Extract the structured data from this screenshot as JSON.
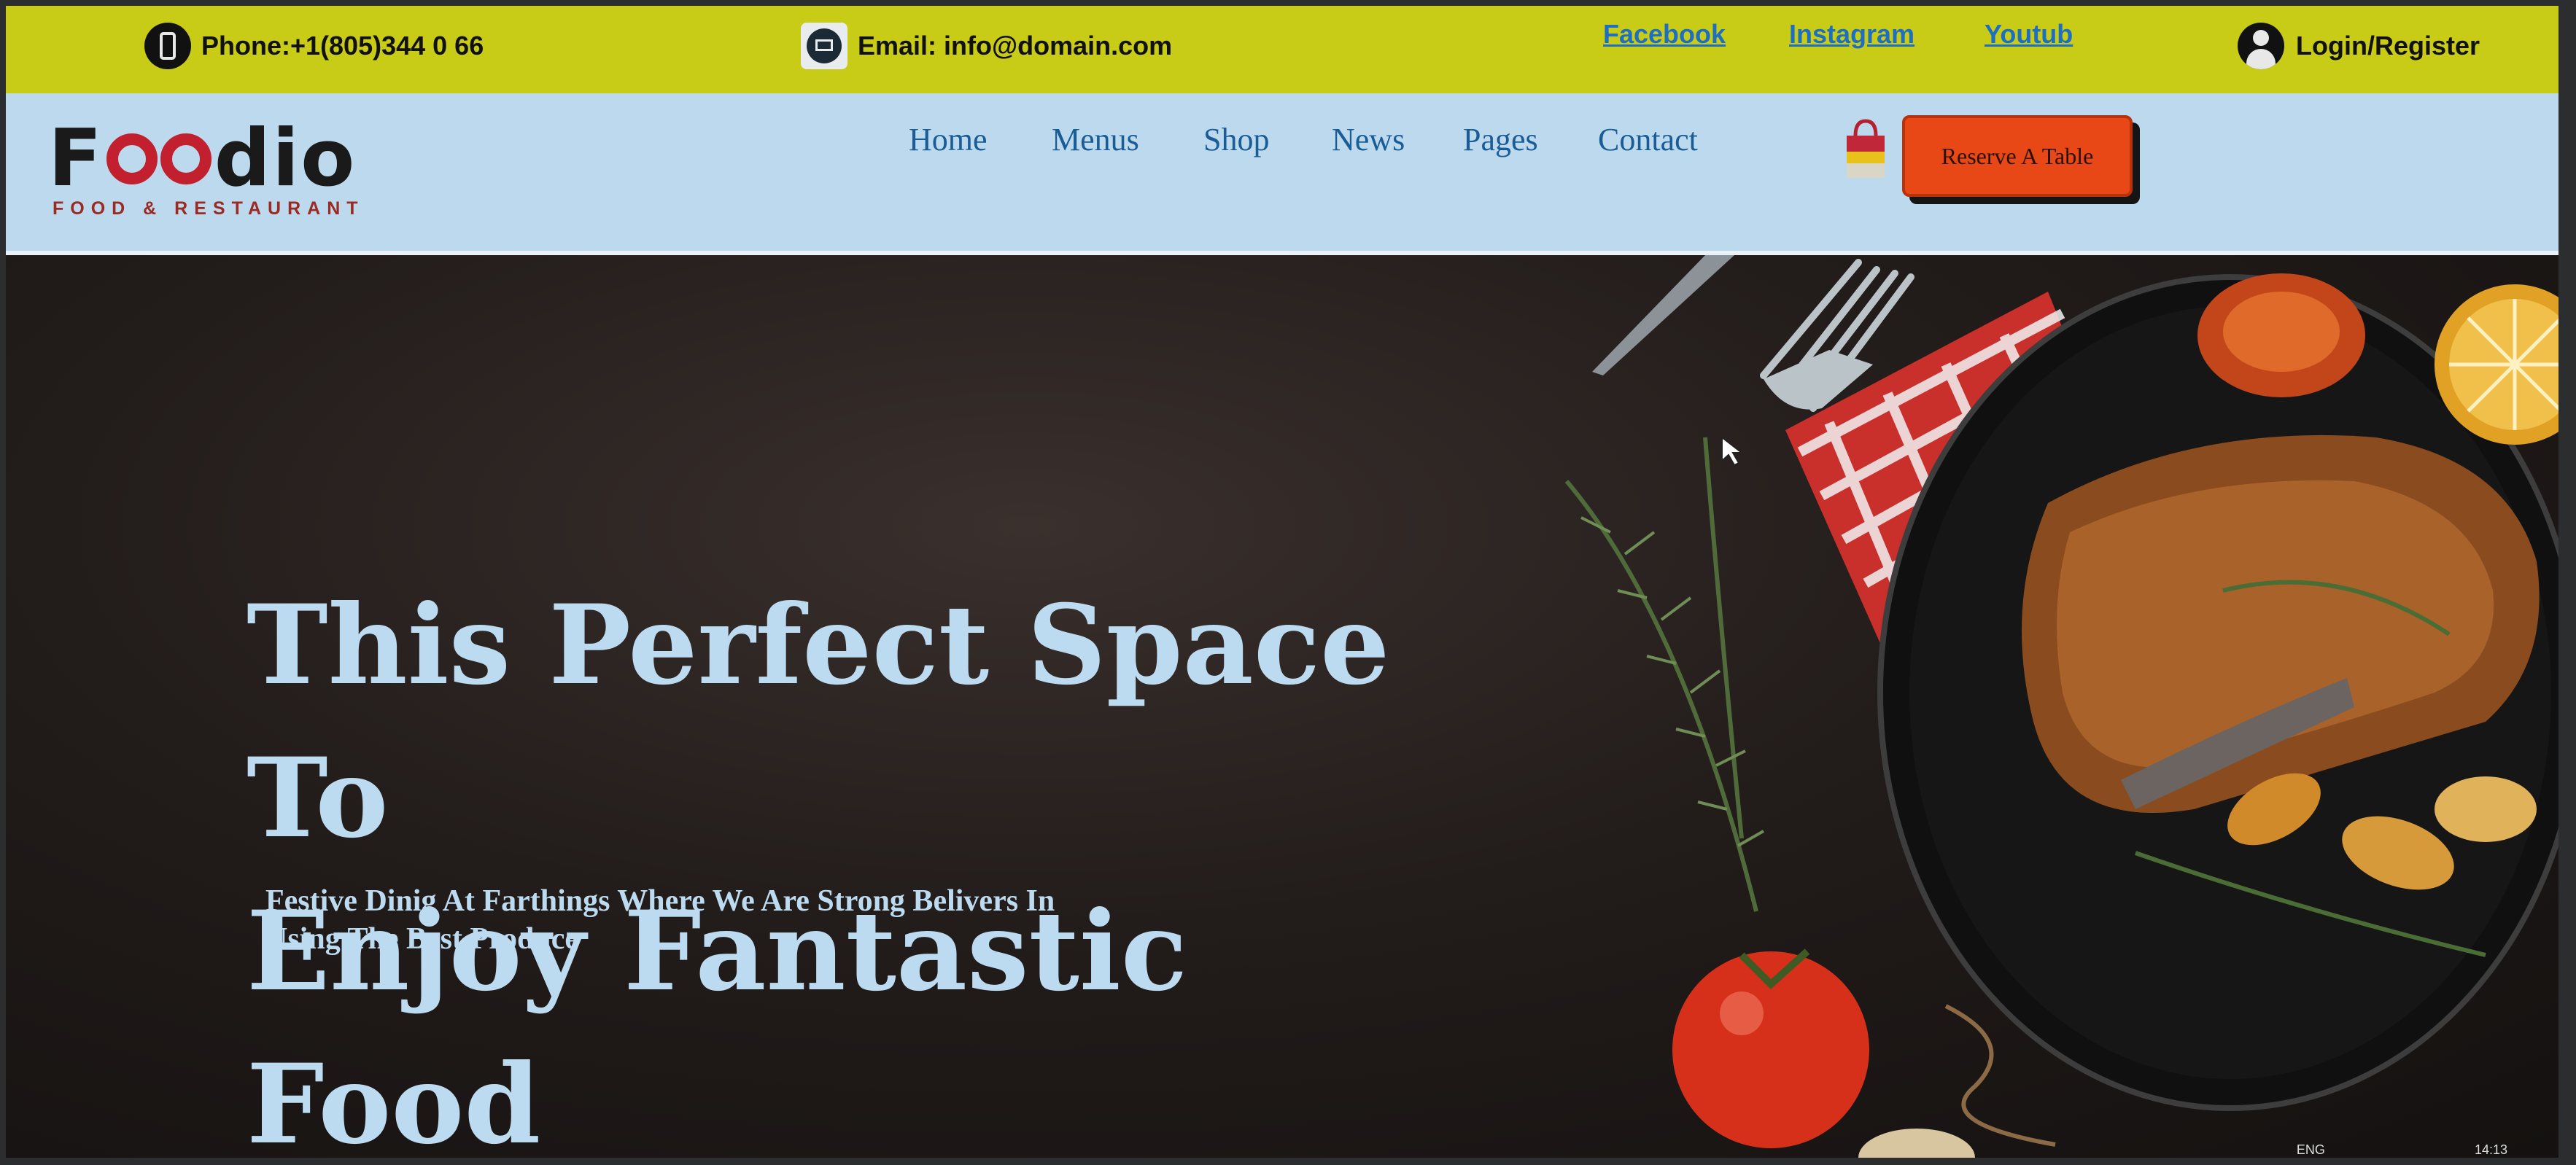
{
  "topbar": {
    "phone": "Phone:+1(805)344 0 66",
    "email": "Email: info@domain.com",
    "social": [
      "Facebook",
      "Instagram",
      "Youtub"
    ],
    "login": "Login/Register"
  },
  "brand": {
    "name_start": "F",
    "name_end": "dio",
    "tagline": "FOOD & RESTAURANT"
  },
  "nav": {
    "items": [
      "Home",
      "Menus",
      "Shop",
      "News",
      "Pages",
      "Contact"
    ],
    "reserve_label": "Reserve A Table"
  },
  "hero": {
    "title_line1": "This Perfect Space To",
    "title_line2": "Enjoy Fantastic Food",
    "subtitle_line1": "Festive Dinig At Farthings Where We Are Strong Belivers In",
    "subtitle_line2": "Using The Best Produce"
  },
  "taskbar": {
    "lang": "ENG",
    "time": "14:13"
  },
  "icons": [
    "phone-icon",
    "email-icon",
    "user-icon",
    "shopping-bag-icon"
  ],
  "colors": {
    "topbar": "#c8cc16",
    "navbar": "#bcd9ee",
    "nav_link": "#1a5c95",
    "social_link": "#1d6fc4",
    "reserve_button": "#e74815",
    "hero_text": "#bcdaf0",
    "logo_accent": "#c2202e"
  }
}
